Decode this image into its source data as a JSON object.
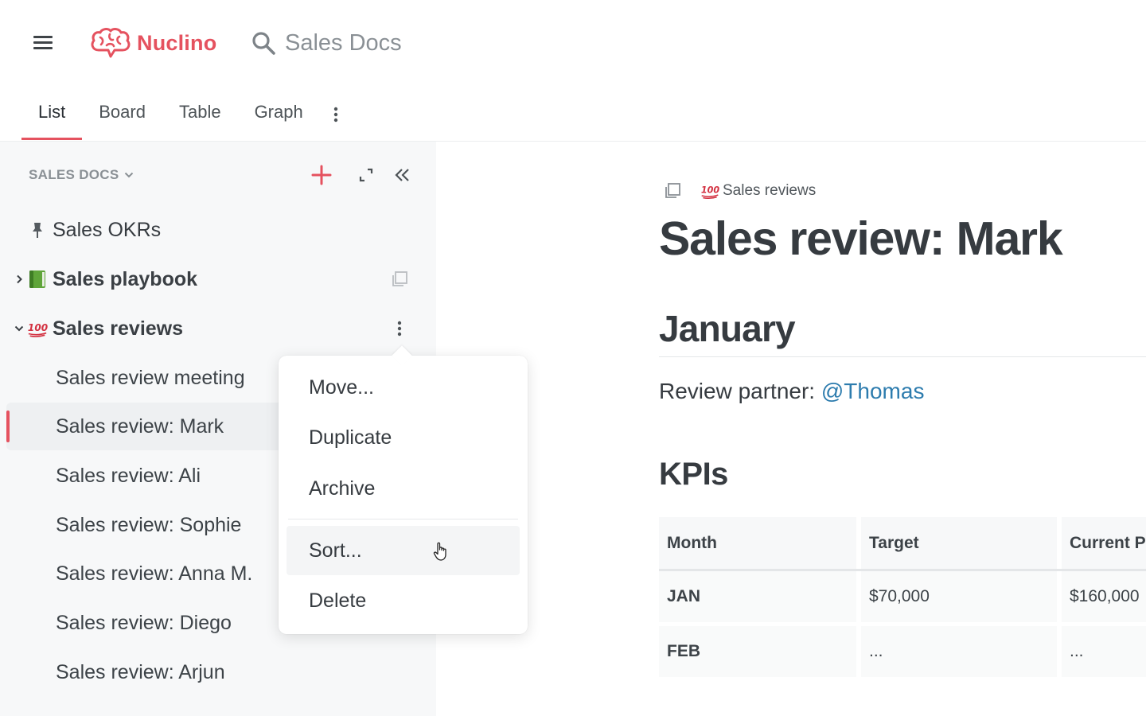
{
  "app": {
    "name": "Nuclino",
    "brand_color": "#e5525f"
  },
  "search": {
    "placeholder": "Sales Docs"
  },
  "tabs": [
    {
      "label": "List",
      "active": true
    },
    {
      "label": "Board",
      "active": false
    },
    {
      "label": "Table",
      "active": false
    },
    {
      "label": "Graph",
      "active": false
    }
  ],
  "sidebar": {
    "workspace": "SALES DOCS",
    "items": [
      {
        "label": "Sales OKRs",
        "icon": "pin-icon"
      },
      {
        "label": "Sales playbook",
        "icon": "green-book-icon"
      },
      {
        "label": "Sales reviews",
        "icon": "hundred-points-icon"
      },
      {
        "label": "Sales review meeting"
      },
      {
        "label": "Sales review: Mark",
        "selected": true
      },
      {
        "label": "Sales review: Ali"
      },
      {
        "label": "Sales review: Sophie"
      },
      {
        "label": "Sales review: Anna M."
      },
      {
        "label": "Sales review: Diego"
      },
      {
        "label": "Sales review: Arjun"
      }
    ]
  },
  "context_menu": {
    "items": [
      "Move...",
      "Duplicate",
      "Archive",
      "Sort...",
      "Delete"
    ],
    "hovered": "Sort..."
  },
  "document": {
    "breadcrumb": "Sales reviews",
    "title": "Sales review: Mark",
    "heading1": "January",
    "partner_label": "Review partner: ",
    "partner_mention": "@Thomas",
    "heading2": "KPIs",
    "table": {
      "headers": [
        "Month",
        "Target",
        "Current P"
      ],
      "rows": [
        [
          "JAN",
          "$70,000",
          "$160,000"
        ],
        [
          "FEB",
          "...",
          "..."
        ]
      ]
    }
  }
}
